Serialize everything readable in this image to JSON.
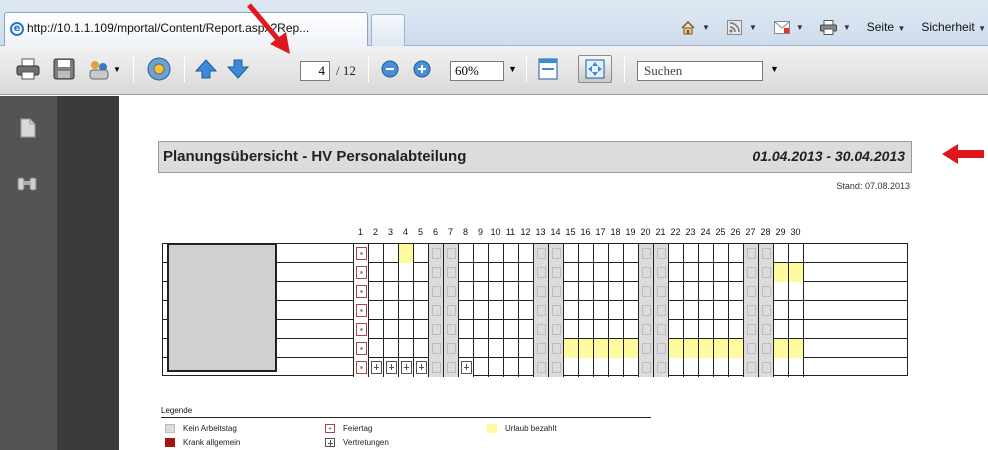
{
  "browser": {
    "tab_title": "http://10.1.1.109/mportal/Content/Report.aspx?Rep...",
    "page_menu": "Seite",
    "security_menu": "Sicherheit"
  },
  "pdf_toolbar": {
    "page_current": "4",
    "page_total": "/ 12",
    "zoom": "60%",
    "search_placeholder": "Suchen"
  },
  "report": {
    "title": "Planungsübersicht - HV Personalabteilung",
    "period": "01.04.2013 - 30.04.2013",
    "stand": "Stand: 07.08.2013",
    "days": [
      "1",
      "2",
      "3",
      "4",
      "5",
      "6",
      "7",
      "8",
      "9",
      "10",
      "11",
      "12",
      "13",
      "14",
      "15",
      "16",
      "17",
      "18",
      "19",
      "20",
      "21",
      "22",
      "23",
      "24",
      "25",
      "26",
      "27",
      "28",
      "29",
      "30"
    ],
    "rows": [
      "HWWVW..WWWWW..WWWWW..WWWWW..WW",
      "HWWWW..WWWWW..WWWWW..WWWWW..VV",
      "HWWWW..WWWWW..WWWWW..WWWWW..WW",
      "HWWWW..WWWWW..WWWWW..WWWWW..WW",
      "HWWWW..WWWWW..WWWWW..WWWWW..WW",
      "HWWWW..WWWWW..VVVVV..VVVVV..VV",
      "HRRRR..RWWWW..WWWWW..WWWWW..WW"
    ],
    "legend": {
      "title": "Legende",
      "items": [
        {
          "label": "Kein Arbeitstag",
          "color": "#dcdcdc"
        },
        {
          "label": "Krank allgemein",
          "color": "#a31515"
        },
        {
          "label": "Feiertag",
          "color": "#ffffff"
        },
        {
          "label": "Vertretungen",
          "color": "#ffffff"
        },
        {
          "label": "Urlaub bezahlt",
          "color": "#fff9a0"
        }
      ]
    }
  },
  "colors": {
    "annotation_arrow": "#e0171b",
    "vacation": "#fff9a0",
    "non_working": "#dcdcdc"
  }
}
